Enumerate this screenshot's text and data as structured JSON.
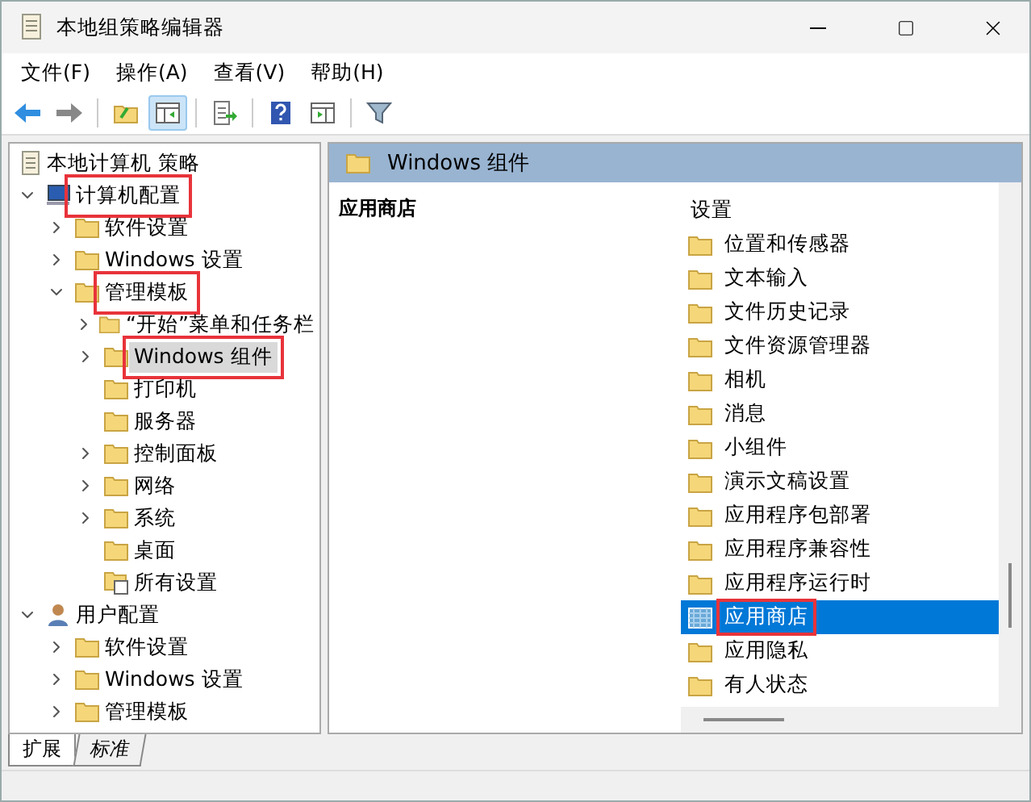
{
  "window": {
    "title": "本地组策略编辑器"
  },
  "menu": [
    "文件(F)",
    "操作(A)",
    "查看(V)",
    "帮助(H)"
  ],
  "toolbar": [
    {
      "kind": "back",
      "pressed": false
    },
    {
      "kind": "forward",
      "pressed": false
    },
    {
      "kind": "up",
      "pressed": false
    },
    {
      "kind": "tree",
      "pressed": true
    },
    {
      "kind": "export",
      "pressed": false
    },
    {
      "kind": "help",
      "pressed": false
    },
    {
      "kind": "pane",
      "pressed": false
    },
    {
      "kind": "filter",
      "pressed": false
    }
  ],
  "tree": {
    "label": "本地计算机 策略",
    "kind": "document",
    "children": [
      {
        "label": "计算机配置",
        "kind": "computer",
        "expanded": true,
        "selected": false,
        "annotated": true,
        "children": [
          {
            "label": "软件设置",
            "kind": "folder",
            "expanded": false,
            "selected": false,
            "annotated": false
          },
          {
            "label": "Windows 设置",
            "kind": "folder",
            "expanded": false,
            "selected": false,
            "annotated": false
          },
          {
            "label": "管理模板",
            "kind": "folder",
            "expanded": true,
            "selected": false,
            "annotated": true,
            "children": [
              {
                "label": "“开始”菜单和任务栏",
                "kind": "folder",
                "expanded": false,
                "selected": false,
                "annotated": false
              },
              {
                "label": "Windows 组件",
                "kind": "folder",
                "expanded": false,
                "selected": true,
                "annotated": true
              },
              {
                "label": "打印机",
                "kind": "folder",
                "selected": false,
                "annotated": false
              },
              {
                "label": "服务器",
                "kind": "folder",
                "selected": false,
                "annotated": false
              },
              {
                "label": "控制面板",
                "kind": "folder",
                "expanded": false,
                "selected": false,
                "annotated": false
              },
              {
                "label": "网络",
                "kind": "folder",
                "expanded": false,
                "selected": false,
                "annotated": false
              },
              {
                "label": "系统",
                "kind": "folder",
                "expanded": false,
                "selected": false,
                "annotated": false
              },
              {
                "label": "桌面",
                "kind": "folder",
                "selected": false,
                "annotated": false
              },
              {
                "label": "所有设置",
                "kind": "settings",
                "selected": false,
                "annotated": false
              }
            ]
          }
        ]
      },
      {
        "label": "用户配置",
        "kind": "user",
        "expanded": true,
        "selected": false,
        "annotated": false,
        "children": [
          {
            "label": "软件设置",
            "kind": "folder",
            "expanded": false,
            "selected": false,
            "annotated": false
          },
          {
            "label": "Windows 设置",
            "kind": "folder",
            "expanded": false,
            "selected": false,
            "annotated": false
          },
          {
            "label": "管理模板",
            "kind": "folder",
            "expanded": false,
            "selected": false,
            "annotated": false
          }
        ]
      }
    ]
  },
  "details": {
    "header": "Windows 组件",
    "description_title": "应用商店",
    "list_header": "设置",
    "items": [
      {
        "label": "位置和传感器",
        "kind": "folder",
        "selected": false,
        "annotated": false
      },
      {
        "label": "文本输入",
        "kind": "folder",
        "selected": false,
        "annotated": false
      },
      {
        "label": "文件历史记录",
        "kind": "folder",
        "selected": false,
        "annotated": false
      },
      {
        "label": "文件资源管理器",
        "kind": "folder",
        "selected": false,
        "annotated": false
      },
      {
        "label": "相机",
        "kind": "folder",
        "selected": false,
        "annotated": false
      },
      {
        "label": "消息",
        "kind": "folder",
        "selected": false,
        "annotated": false
      },
      {
        "label": "小组件",
        "kind": "folder",
        "selected": false,
        "annotated": false
      },
      {
        "label": "演示文稿设置",
        "kind": "folder",
        "selected": false,
        "annotated": false
      },
      {
        "label": "应用程序包部署",
        "kind": "folder",
        "selected": false,
        "annotated": false
      },
      {
        "label": "应用程序兼容性",
        "kind": "folder",
        "selected": false,
        "annotated": false
      },
      {
        "label": "应用程序运行时",
        "kind": "folder",
        "selected": false,
        "annotated": false
      },
      {
        "label": "应用商店",
        "kind": "policy",
        "selected": true,
        "annotated": true
      },
      {
        "label": "应用隐私",
        "kind": "folder",
        "selected": false,
        "annotated": false
      },
      {
        "label": "有人状态",
        "kind": "folder",
        "selected": false,
        "annotated": false
      }
    ]
  },
  "view_tabs": [
    {
      "label": "扩展",
      "selected": true
    },
    {
      "label": "标准",
      "selected": false
    }
  ]
}
